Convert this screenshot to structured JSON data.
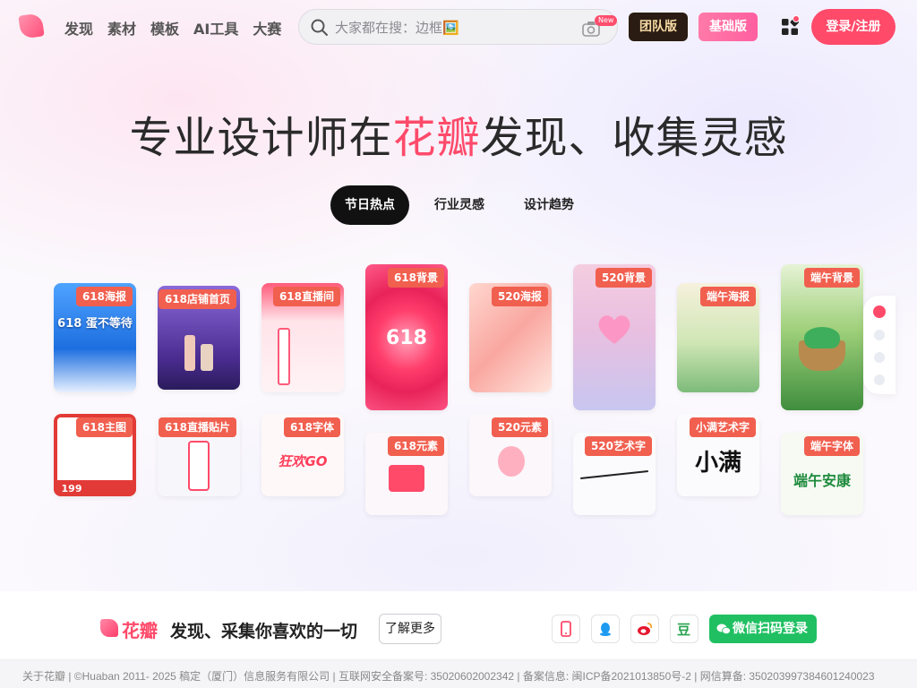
{
  "header": {
    "nav": [
      "发现",
      "素材",
      "模板",
      "AI工具",
      "大赛"
    ],
    "search_placeholder": "大家都在搜：边框🖼️",
    "new_badge": "New",
    "team_label": "团队版",
    "basic_label": "基础版",
    "login_label": "登录/注册"
  },
  "hero": {
    "title_pre": "专业设计师在",
    "title_accent": "花瓣",
    "title_post": "发现、收集灵感",
    "tabs": [
      "节日热点",
      "行业灵感",
      "设计趋势"
    ],
    "active_tab": 0
  },
  "cards": [
    {
      "label": "618海报",
      "sub": "618 蛋不等待"
    },
    {
      "label": "618店铺首页",
      "sub": ""
    },
    {
      "label": "618直播间",
      "sub": ""
    },
    {
      "label": "618背景",
      "sub": "618"
    },
    {
      "label": "520海报",
      "sub": ""
    },
    {
      "label": "520背景",
      "sub": ""
    },
    {
      "label": "端午海报",
      "sub": ""
    },
    {
      "label": "端午背景",
      "sub": ""
    },
    {
      "label": "618主图",
      "sub": "199"
    },
    {
      "label": "618直播贴片",
      "sub": ""
    },
    {
      "label": "618字体",
      "sub": "狂欢GO"
    },
    {
      "label": "618元素",
      "sub": ""
    },
    {
      "label": "520元素",
      "sub": ""
    },
    {
      "label": "520艺术字",
      "sub": ""
    },
    {
      "label": "小满艺术字",
      "sub": "小满"
    },
    {
      "label": "端午字体",
      "sub": "端午安康"
    }
  ],
  "carousel": {
    "dots": 4,
    "active": 0
  },
  "bottom": {
    "brand": "花瓣",
    "slogan": "发现、采集你喜欢的一切",
    "learn_more": "了解更多",
    "wechat_login": "微信扫码登录",
    "social_icons": [
      "phone-icon",
      "qq-icon",
      "weibo-icon",
      "douban-icon"
    ],
    "douban_char": "豆"
  },
  "footer": {
    "text": "关于花瓣 | ©Huaban 2011- 2025 稿定（厦门）信息服务有限公司 | 互联网安全备案号: 35020602002342 | 备案信息: 闽ICP备2021013850号-2 | 网信算备: 350203997384601240023"
  },
  "colors": {
    "accent": "#ff4a6a",
    "team_bg": "#2a1c12",
    "wechat": "#20c062"
  }
}
